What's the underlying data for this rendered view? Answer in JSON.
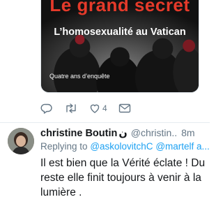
{
  "previous_tweet": {
    "media": {
      "headline": "Le grand secret",
      "subtitle": "L’homosexualité au Vatican",
      "small_text": "Quatre ans d’enquête"
    },
    "actions": {
      "reply_icon": "reply-icon",
      "retweet_icon": "retweet-icon",
      "like_icon": "heart-icon",
      "like_count": "4",
      "dm_icon": "envelope-icon"
    }
  },
  "reply_tweet": {
    "display_name": "christine Boutin",
    "name_emoji": "ن",
    "handle": "@christin..",
    "timestamp": "8m",
    "replying_prefix": "Replying to",
    "mention_1": "@askolovitchC",
    "mention_2": "@martelf a...",
    "text": "Il est bien que la Vérité éclate ! Du reste elle finit toujours à venir à la lumière ."
  },
  "colors": {
    "accent": "#1da1f2",
    "secondary_text": "#657786",
    "headline_red": "#e53a2a"
  }
}
